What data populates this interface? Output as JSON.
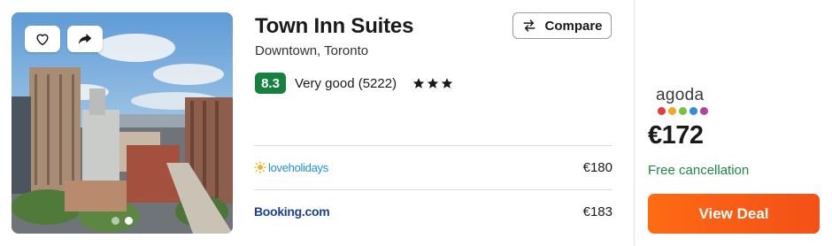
{
  "hotel": {
    "name": "Town Inn Suites",
    "location": "Downtown, Toronto",
    "score": "8.3",
    "rating_label": "Very good (5222)",
    "stars": 3
  },
  "photo": {
    "favorite_icon": "heart-icon",
    "share_icon": "share-arrow-icon",
    "carousel_dots": 2,
    "active_dot": 1
  },
  "compare": {
    "label": "Compare",
    "icon": "swap-arrows-icon"
  },
  "providers": [
    {
      "name": "loveholidays",
      "price": "€180"
    },
    {
      "name": "Booking.com",
      "price": "€183"
    }
  ],
  "deal": {
    "provider": "agoda",
    "price": "€172",
    "cancellation": "Free cancellation",
    "button_label": "View Deal"
  },
  "colors": {
    "score_badge": "#16813f",
    "cancellation": "#1a8a44",
    "deal_button": "#f25018",
    "agoda_dots": [
      "#e83a3a",
      "#f5a623",
      "#7ac143",
      "#2f8ee0",
      "#b2429c"
    ]
  }
}
